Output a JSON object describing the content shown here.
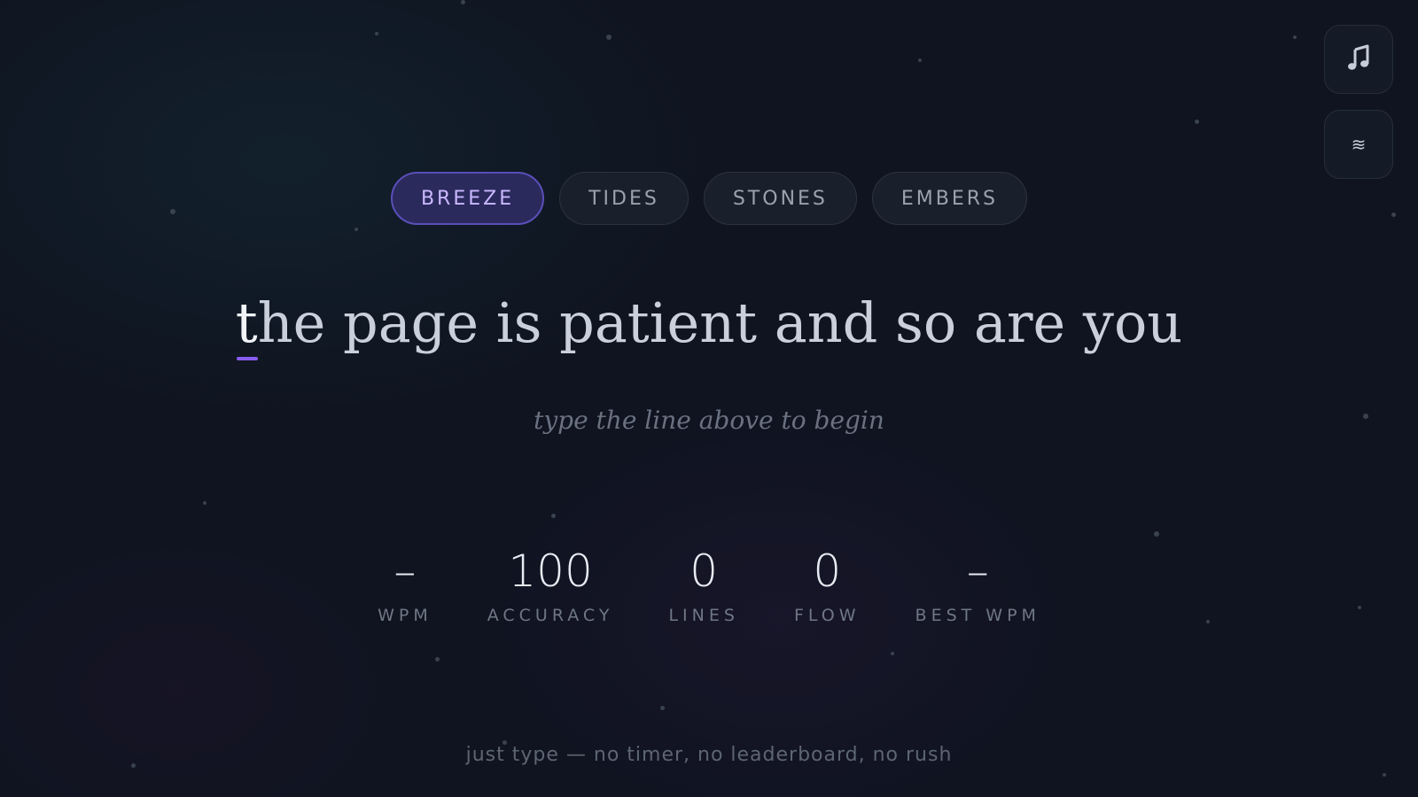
{
  "controls": {
    "music_icon": "music-note-icon",
    "ambient_icon": "waves-icon",
    "ambient_glyph": "≋"
  },
  "modes": [
    {
      "label": "BREEZE",
      "active": true
    },
    {
      "label": "TIDES",
      "active": false
    },
    {
      "label": "STONES",
      "active": false
    },
    {
      "label": "EMBERS",
      "active": false
    }
  ],
  "prompt": {
    "current_char": "t",
    "remaining": "he page is patient and so are you"
  },
  "hint": "type the line above to begin",
  "stats": [
    {
      "value": "–",
      "label": "WPM"
    },
    {
      "value": "100",
      "label": "ACCURACY"
    },
    {
      "value": "0",
      "label": "LINES"
    },
    {
      "value": "0",
      "label": "FLOW"
    },
    {
      "value": "–",
      "label": "BEST WPM"
    }
  ],
  "footer": "just type — no timer, no leaderboard, no rush",
  "colors": {
    "background": "#0f1420",
    "accent": "#8a5cf0",
    "active_mode_bg": "#2b2a5c",
    "active_mode_text": "#c9b8ff"
  }
}
